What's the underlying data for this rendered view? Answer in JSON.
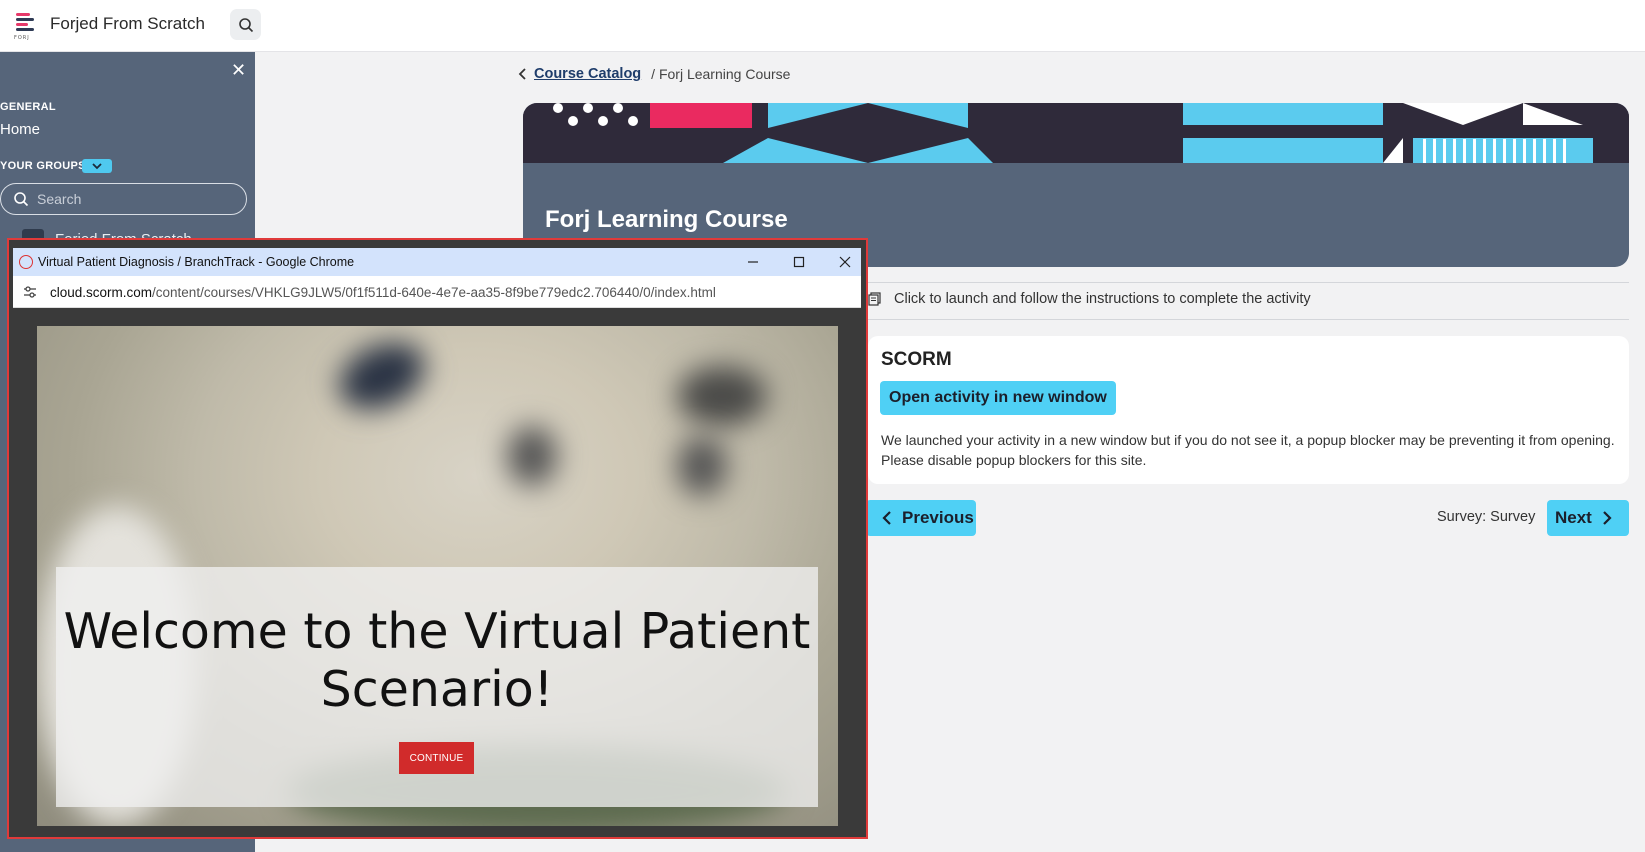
{
  "app": {
    "title": "Forjed From Scratch",
    "logo_text": "FORJ",
    "accent_color": "#4fd0f5"
  },
  "sidebar": {
    "close_icon": "close-icon",
    "general_label": "GENERAL",
    "home_label": "Home",
    "groups_label": "YOUR GROUPS",
    "search_placeholder": "Search",
    "group_name": "Forjed From Scratch"
  },
  "breadcrumb": {
    "link": "Course Catalog",
    "separator": "/",
    "current": "Forj Learning Course"
  },
  "course": {
    "title": "Forj Learning Course"
  },
  "activity": {
    "instructions": "Click to launch and follow the instructions to complete the activity",
    "card_title": "SCORM",
    "open_button": "Open activity in new window",
    "note": "We launched your activity in a new window but if you do not see it, a popup blocker may be preventing it from opening. Please disable popup blockers for this site."
  },
  "navigation": {
    "previous": "Previous",
    "next_label": "Survey: Survey",
    "next": "Next"
  },
  "popup": {
    "window_title": "Virtual Patient Diagnosis / BranchTrack - Google Chrome",
    "url_host": "cloud.scorm.com",
    "url_path": "/content/courses/VHKLG9JLW5/0f1f511d-640e-4e7e-aa35-8f9be779edc2.706440/0/index.html",
    "welcome": "Welcome to the Virtual Patient Scenario!",
    "continue": "CONTINUE",
    "border_color": "#e03a3a"
  }
}
